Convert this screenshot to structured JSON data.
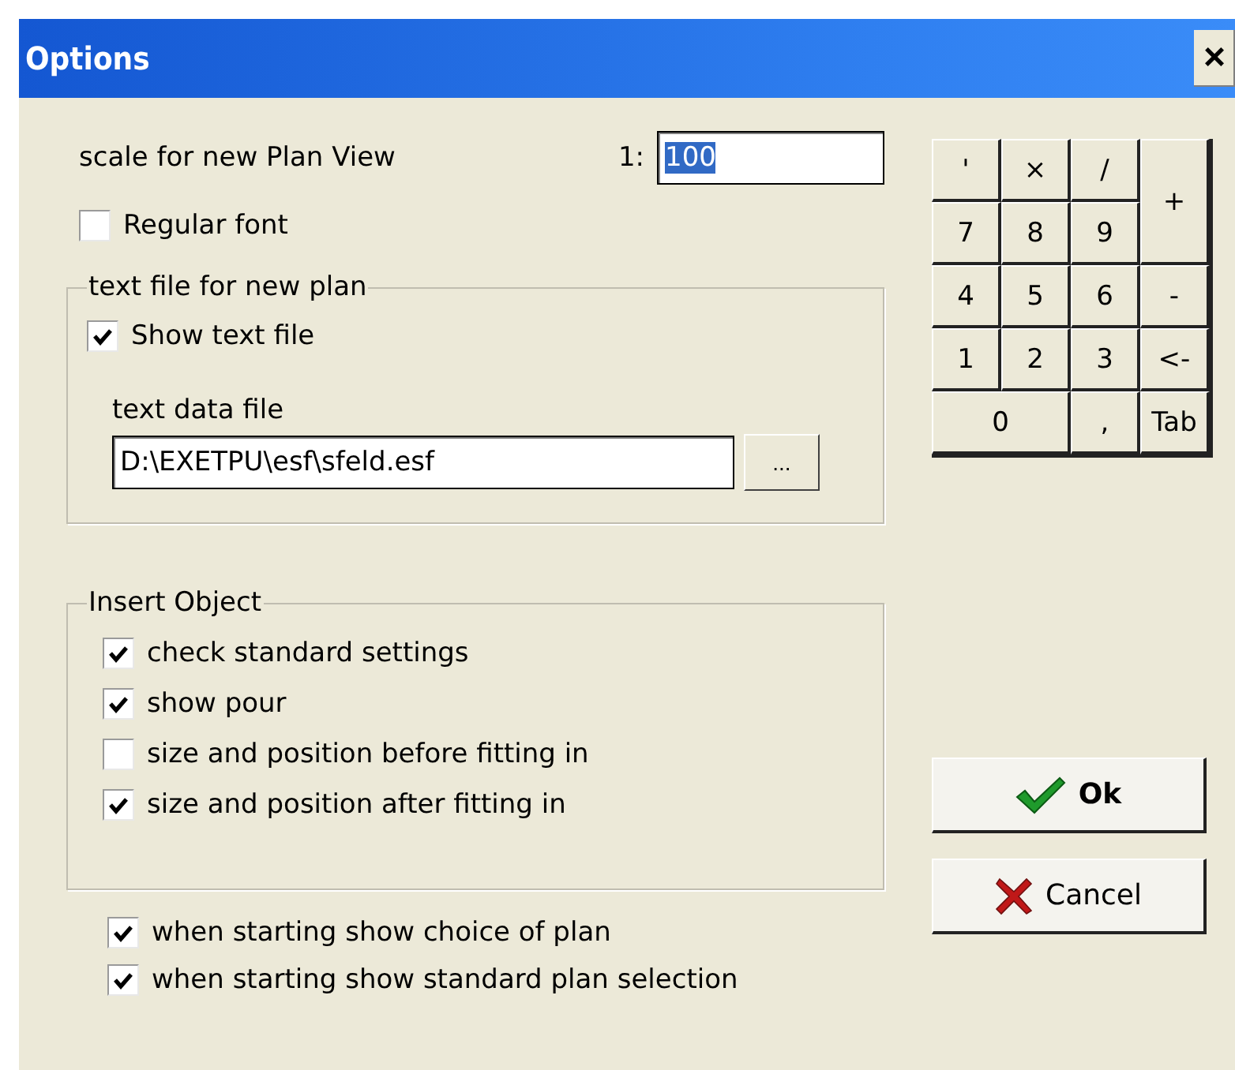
{
  "window": {
    "title": "Options",
    "close": "×"
  },
  "scale": {
    "label": "scale for new Plan View",
    "prefix": "1:",
    "value": "100",
    "selected": true
  },
  "regular_font": {
    "label": "Regular font",
    "checked": false
  },
  "text_file_group": {
    "title": "text file for new plan",
    "show_text_file": {
      "label": "Show text file",
      "checked": true
    },
    "file_label": "text data file",
    "file_value": "D:\\EXETPU\\esf\\sfeld.esf",
    "browse": "..."
  },
  "insert_object": {
    "title": "Insert Object",
    "options": [
      {
        "label": "check standard settings",
        "checked": true
      },
      {
        "label": "show pour",
        "checked": true
      },
      {
        "label": "size and position before fitting in",
        "checked": false
      },
      {
        "label": "size and position after fitting in",
        "checked": true
      }
    ]
  },
  "startup_options": [
    {
      "label": "when starting show choice of plan",
      "checked": true
    },
    {
      "label": "when starting show standard plan selection",
      "checked": true
    }
  ],
  "keypad": [
    {
      "label": "'",
      "kind": "normal"
    },
    {
      "label": "×",
      "kind": "normal"
    },
    {
      "label": "/",
      "kind": "normal"
    },
    {
      "label": "+",
      "kind": "tall"
    },
    {
      "label": "7",
      "kind": "normal"
    },
    {
      "label": "8",
      "kind": "normal"
    },
    {
      "label": "9",
      "kind": "normal"
    },
    {
      "label": "4",
      "kind": "normal"
    },
    {
      "label": "5",
      "kind": "normal"
    },
    {
      "label": "6",
      "kind": "normal"
    },
    {
      "label": "-",
      "kind": "normal"
    },
    {
      "label": "1",
      "kind": "normal"
    },
    {
      "label": "2",
      "kind": "normal"
    },
    {
      "label": "3",
      "kind": "normal"
    },
    {
      "label": "<-",
      "kind": "normal"
    },
    {
      "label": "0",
      "kind": "wide"
    },
    {
      "label": ",",
      "kind": "normal"
    },
    {
      "label": "Tab",
      "kind": "normal"
    }
  ],
  "buttons": [
    {
      "label": "Ok",
      "kind": "ok"
    },
    {
      "label": "Cancel",
      "kind": "cancel"
    }
  ]
}
